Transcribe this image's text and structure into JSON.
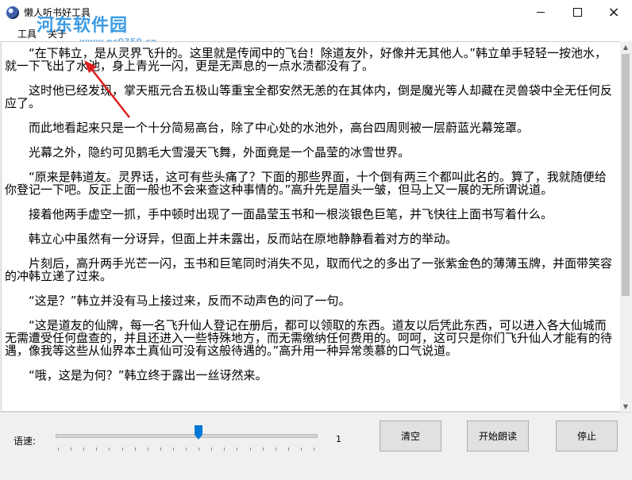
{
  "window": {
    "title": "懒人听书好工具",
    "watermark": "河东软件园",
    "watermark_url": "www.pc0359.cn",
    "controls": {
      "minimize": "minimize",
      "maximize": "maximize",
      "close": "×"
    }
  },
  "menu": {
    "items": [
      "工具",
      "关于"
    ]
  },
  "text": {
    "paragraphs": [
      "“在下韩立，是从灵界飞升的。这里就是传闻中的飞台！除道友外，好像并无其他人。”韩立单手轻轻一按池水，就一下飞出了水池，身上青光一闪，更是无声息的一点水渍都没有了。",
      "这时他已经发现，掌天瓶元合五极山等重宝全都安然无恙的在其体内，倒是魔光等人却藏在灵兽袋中全无任何反应了。",
      "而此地看起来只是一个十分简易高台，除了中心处的水池外，高台四周则被一层蔚蓝光幕笼罩。",
      "光幕之外，隐约可见鹅毛大雪漫天飞舞，外面竟是一个晶莹的冰雪世界。",
      "“原来是韩道友。灵界话，这可有些头痛了？下面的那些界面，十个倒有两三个都叫此名的。算了，我就随便给你登记一下吧。反正上面一般也不会来查这种事情的。”高升先是眉头一皱，但马上又一展的无所谓说道。",
      "接着他两手虚空一抓，手中顿时出现了一面晶莹玉书和一根淡银色巨笔，并飞快往上面书写着什么。",
      "韩立心中虽然有一分讶异，但面上并未露出，反而站在原地静静看着对方的举动。",
      "片刻后，高升两手光芒一闪，玉书和巨笔同时消失不见，取而代之的多出了一张紫金色的薄薄玉牌，并面带笑容的冲韩立递了过来。",
      "“这是？”韩立并没有马上接过来，反而不动声色的问了一句。",
      "“这是道友的仙牌，每一名飞升仙人登记在册后，都可以领取的东西。道友以后凭此东西，可以进入各大仙城而无需遭受任何盘查的，并且还进入一些特殊地方，而无需缴纳任何费用的。呵呵，这可只是你们飞升仙人才能有的待遇，像我等这些从仙界本土真仙可没有这般待遇的。”高升用一种异常羡慕的口气说道。",
      "“哦，这是为何？”韩立终于露出一丝讶然来。"
    ]
  },
  "controls": {
    "speed_label": "语速:",
    "speed_value": "1",
    "speed_fraction": 0.55,
    "buttons": {
      "clear": "清空",
      "start": "开始朗读",
      "stop": "停止"
    }
  },
  "colors": {
    "accent": "#1a73e8",
    "arrow": "#e02020"
  }
}
